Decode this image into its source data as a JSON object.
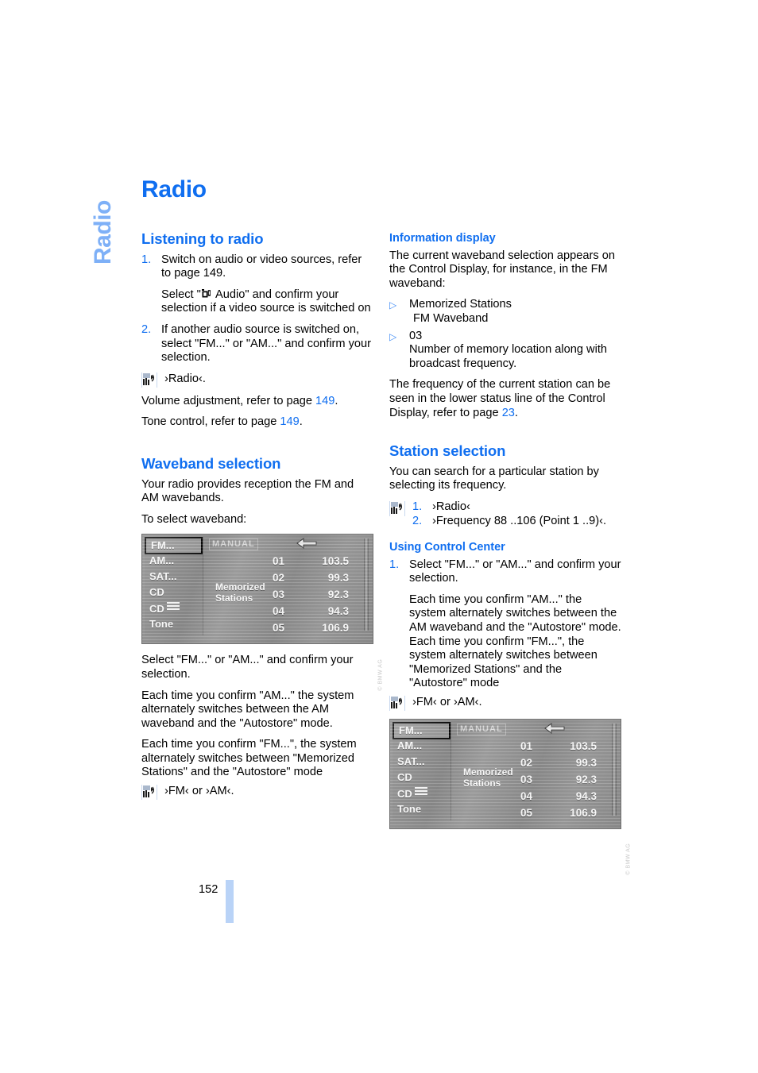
{
  "chapter_tab": {
    "label": "Radio"
  },
  "page_title": "Radio",
  "folio": {
    "page_number": "152"
  },
  "left_column": {
    "section1": {
      "heading": "Listening to radio",
      "steps": [
        {
          "num": "1.",
          "lines": [
            "Switch on audio or video sources, refer to page 149.",
            "Select \" Audio\" and confirm your selection if a video source is switched on"
          ],
          "line1a": "Switch on audio or video sources, refer",
          "line1b": "to page 149.",
          "line2_pre": "Select \"",
          "line2_post": " Audio\" and confirm your selection if a video source is switched on"
        },
        {
          "num": "2.",
          "text": "If another audio source is switched on, select \"FM...\" or \"AM...\" and confirm your selection."
        }
      ],
      "voice_command": "›Radio‹.",
      "volume_line_pre": "Volume adjustment, refer to page ",
      "volume_page": "149",
      "volume_line_post": ".",
      "tone_line_pre": "Tone control, refer to page ",
      "tone_page": "149",
      "tone_line_post": "."
    },
    "section2": {
      "heading": "Waveband selection",
      "intro": "Your radio provides reception the FM and AM wavebands.",
      "subintro": "To select waveband:",
      "after_image_1": "Select \"FM...\" or \"AM...\" and confirm your selection.",
      "after_image_2": "Each time you confirm \"AM...\" the system alternately switches between the AM waveband and the \"Autostore\" mode.",
      "after_image_3": "Each time you confirm \"FM...\", the system alternately switches between \"Memorized Stations\" and the \"Autostore\" mode",
      "voice_command": "›FM‹ or ›AM‹."
    }
  },
  "right_column": {
    "section1": {
      "heading": "Information display",
      "intro": "The current waveband selection appears on the Control Display, for instance, in the FM waveband:",
      "bullets": [
        {
          "line1": "Memorized Stations",
          "line2": "FM Waveband"
        },
        {
          "line1": "03",
          "line2": "Number of memory location along with broadcast frequency."
        }
      ],
      "outro_pre": "The frequency of the current station can be seen in the lower status line of the Control Display, refer to page ",
      "outro_page": "23",
      "outro_post": "."
    },
    "section2": {
      "heading": "Station selection",
      "intro": "You can search for a particular station by selecting its frequency.",
      "voice_steps": [
        {
          "num": "1.",
          "text": "›Radio‹"
        },
        {
          "num": "2.",
          "text": "›Frequency 88 ..106 (Point 1 ..9)‹."
        }
      ]
    },
    "section3": {
      "heading": "Using Control Center",
      "steps": [
        {
          "num": "1.",
          "text": "Select \"FM...\" or \"AM...\" and confirm your selection."
        }
      ],
      "para2": "Each time you confirm \"AM...\" the system alternately switches between the AM waveband and the \"Autostore\" mode.",
      "para3": "Each time you confirm \"FM...\", the system alternately switches between \"Memorized Stations\" and the \"Autostore\" mode",
      "voice_command": "›FM‹ or ›AM‹."
    }
  },
  "display_screenshot": {
    "menu_items": [
      {
        "label": "FM...",
        "selected": true,
        "has_list_icon": false
      },
      {
        "label": "AM...",
        "selected": false,
        "has_list_icon": false
      },
      {
        "label": "SAT...",
        "selected": false,
        "has_list_icon": false
      },
      {
        "label": "CD",
        "selected": false,
        "has_list_icon": false
      },
      {
        "label": "CD",
        "selected": false,
        "has_list_icon": true
      },
      {
        "label": "Tone",
        "selected": false,
        "has_list_icon": false
      }
    ],
    "status_label": "MANUAL",
    "center_label_line1": "Memorized",
    "center_label_line2": "Stations",
    "presets": [
      {
        "num": "01",
        "freq": "103.5"
      },
      {
        "num": "02",
        "freq": "99.3"
      },
      {
        "num": "03",
        "freq": "92.3"
      },
      {
        "num": "04",
        "freq": "94.3"
      },
      {
        "num": "05",
        "freq": "106.9"
      }
    ],
    "credit": "© BMW AG"
  },
  "colors": {
    "heading_blue": "#0f6ef0",
    "tab_blue": "#7eb0f7",
    "folio_bar_blue": "#b9d3f7",
    "bullet_blue": "#3d8af5"
  }
}
